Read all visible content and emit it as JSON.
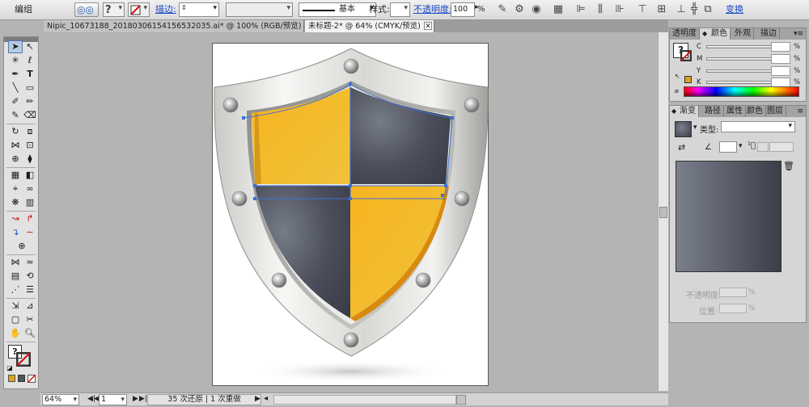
{
  "control_bar": {
    "selection_label": "编组",
    "stroke_label": "描边:",
    "stroke_style_label": "基本",
    "style_label": "样式:",
    "opacity_label": "不透明度:",
    "opacity_value": "100",
    "opacity_unit": "%",
    "transform_label": "变换"
  },
  "document_tabs": [
    {
      "label": "Nipic_10673188_20180306154156532035.ai* @ 100% (RGB/预览)"
    },
    {
      "label": "未标题-2* @ 64% (CMYK/预览)"
    }
  ],
  "status_bar": {
    "zoom": "64%",
    "artboard_number": "1",
    "history_text": "35 次还原 | 1 次重做"
  },
  "color_panel": {
    "tabs": [
      "透明度",
      "颜色",
      "外观",
      "描边"
    ],
    "active_tab": "颜色",
    "sliders": [
      {
        "label": "C"
      },
      {
        "label": "M"
      },
      {
        "label": "Y"
      },
      {
        "label": "K"
      }
    ],
    "percent_sign": "%",
    "fill_swatch_color": "#e0a020"
  },
  "gradient_panel": {
    "tabs": [
      "渐变",
      "路径",
      "属性",
      "颜色",
      "图层"
    ],
    "active_tab": "渐变",
    "type_label": "类型:",
    "opacity_label": "不透明度:",
    "location_label": "位置:",
    "percent_sign": "%",
    "gradient_colors": [
      "#7a7f8c",
      "#3b3e48"
    ]
  },
  "colors": {
    "shield_yellow": "#f2b51c",
    "shield_yellow_dark": "#de8e10",
    "shield_gray": "#454955",
    "selection_blue": "#3e6fd8"
  }
}
